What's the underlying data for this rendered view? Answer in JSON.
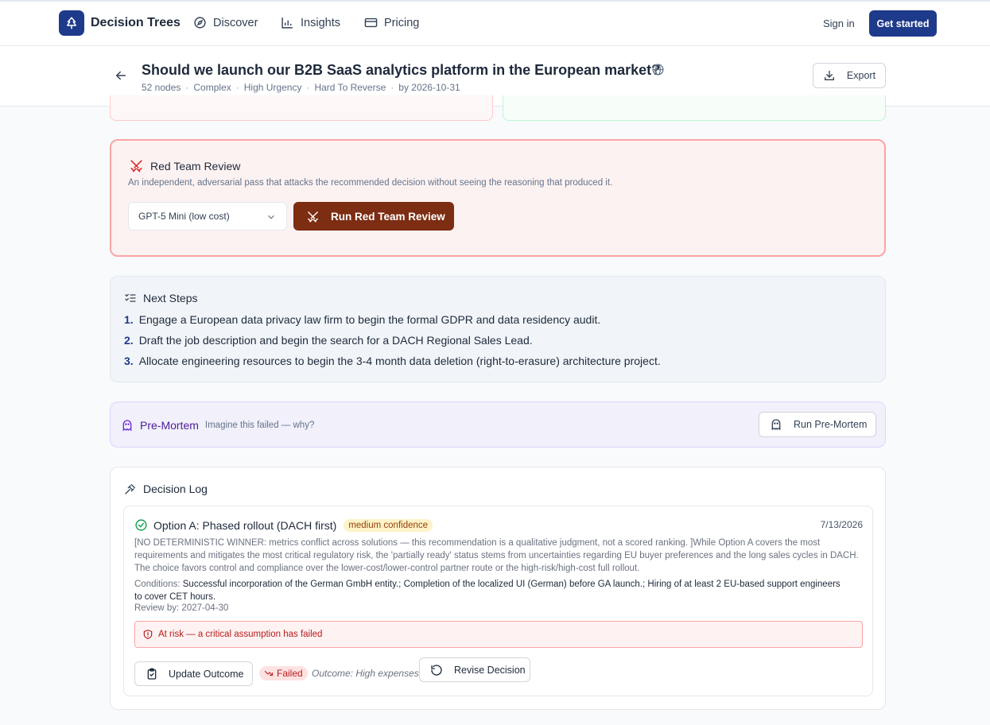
{
  "nav": {
    "brand": "Decision Trees",
    "items": [
      {
        "label": "Discover",
        "icon": "compass-icon"
      },
      {
        "label": "Insights",
        "icon": "bar-chart-icon"
      },
      {
        "label": "Pricing",
        "icon": "credit-card-icon"
      }
    ],
    "sign_in": "Sign in",
    "get_started": "Get started",
    "accent": "#1e3a8a"
  },
  "header": {
    "title": "Should we launch our B2B SaaS analytics platform in the European market?",
    "meta": [
      "52 nodes",
      "Complex",
      "High Urgency",
      "Hard To Reverse",
      "by 2026-10-31"
    ],
    "export": "Export"
  },
  "red_team": {
    "title": "Red Team Review",
    "description": "An independent, adversarial pass that attacks the recommended decision without seeing the reasoning that produced it.",
    "model_selected": "GPT-5 Mini (low cost)",
    "run_button": "Run Red Team Review"
  },
  "next_steps": {
    "title": "Next Steps",
    "items": [
      {
        "num": "1.",
        "text": "Engage a European data privacy law firm to begin the formal GDPR and data residency audit."
      },
      {
        "num": "2.",
        "text": "Draft the job description and begin the search for a DACH Regional Sales Lead."
      },
      {
        "num": "3.",
        "text": "Allocate engineering resources to begin the 3-4 month data deletion (right-to-erasure) architecture project."
      }
    ]
  },
  "pre_mortem": {
    "title": "Pre-Mortem",
    "subtitle": "Imagine this failed — why?",
    "button": "Run Pre-Mortem"
  },
  "decision_log": {
    "title": "Decision Log",
    "entry": {
      "option": "Option A: Phased rollout (DACH first)",
      "confidence": "medium confidence",
      "date": "7/13/2026",
      "rationale": "[NO DETERMINISTIC WINNER: metrics conflict across solutions — this recommendation is a qualitative judgment, not a scored ranking. ]While Option A covers the most requirements and mitigates the most critical regulatory risk, the 'partially ready' status stems from uncertainties regarding EU buyer preferences and the long sales cycles in DACH. The choice favors control and compliance over the lower-cost/lower-control partner route or the high-risk/high-cost full rollout.",
      "conditions_label": "Conditions:",
      "conditions": "Successful incorporation of the German GmbH entity.; Completion of the localized UI (German) before GA launch.; Hiring of at least 2 EU-based support engineers to cover CET hours.",
      "review_by": "Review by: 2027-04-30",
      "risk": "At risk — a critical assumption has failed",
      "update_button": "Update Outcome",
      "status": "Failed",
      "outcome": "Outcome: High expenses",
      "revise_button": "Revise Decision"
    }
  }
}
